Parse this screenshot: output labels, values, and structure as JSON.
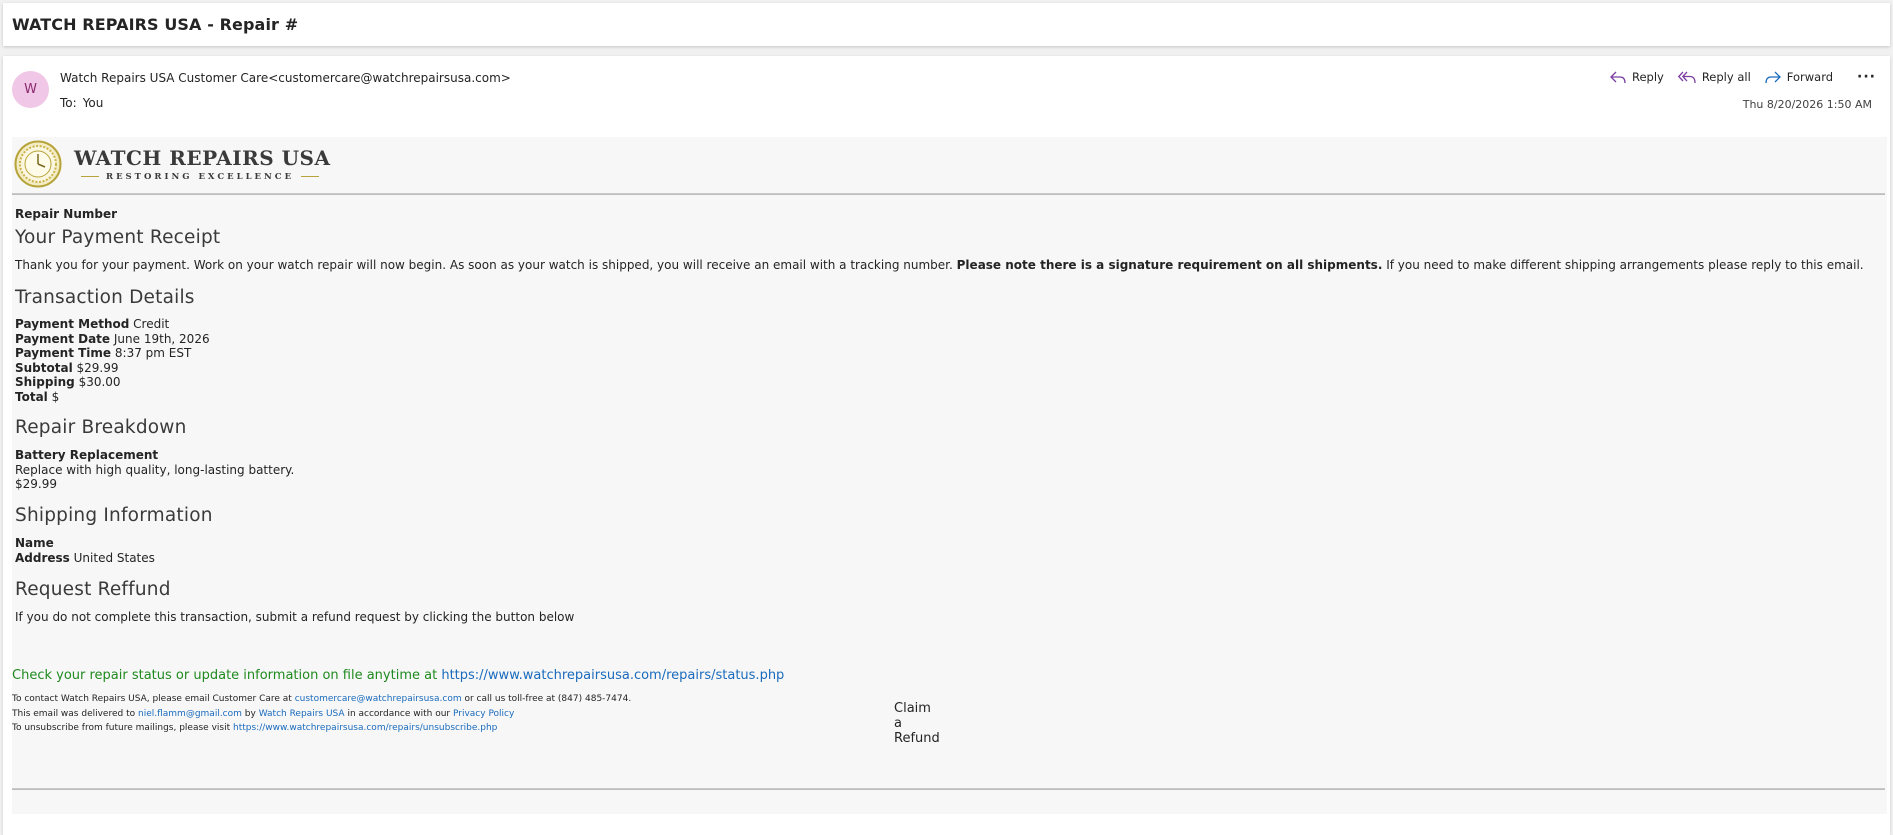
{
  "subject": "WATCH REPAIRS USA - Repair #",
  "sender": {
    "avatar_initial": "W",
    "display": "Watch Repairs USA Customer Care<customercare@watchrepairsusa.com>",
    "to_label": "To:",
    "to_value": "You",
    "date": "Thu 8/20/2026 1:50 AM"
  },
  "actions": {
    "reply": "Reply",
    "reply_all": "Reply all",
    "forward": "Forward",
    "more": "···"
  },
  "logo": {
    "title": "WATCH REPAIRS USA",
    "tagline": "RESTORING EXCELLENCE"
  },
  "body": {
    "repair_number_label": "Repair Number",
    "receipt_heading": "Your Payment Receipt",
    "receipt_text_1": "Thank you for your payment. Work on your watch repair will now begin. As soon as your watch is shipped, you will receive an email with a tracking number.",
    "receipt_text_bold": "Please note there is a signature requirement on all shipments.",
    "receipt_text_2": "If you need to make different shipping arrangements please reply to this email.",
    "transaction_heading": "Transaction Details",
    "transaction": [
      {
        "label": "Payment Method",
        "value": "Credit"
      },
      {
        "label": "Payment Date",
        "value": "June 19th, 2026"
      },
      {
        "label": "Payment Time",
        "value": "8:37 pm EST"
      },
      {
        "label": "Subtotal",
        "value": "$29.99"
      },
      {
        "label": "Shipping",
        "value": "$30.00"
      },
      {
        "label": "Total",
        "value": "$"
      }
    ],
    "breakdown_heading": "Repair Breakdown",
    "breakdown_item": "Battery Replacement",
    "breakdown_desc": "Replace with high quality, long-lasting battery.",
    "breakdown_price": "$29.99",
    "shipping_heading": "Shipping Information",
    "shipping_name_label": "Name",
    "shipping_address_label": "Address",
    "shipping_address_value": "United States",
    "refund_heading": "Request Reffund",
    "refund_text": "If you do not complete this transaction, submit a refund request by clicking the button below",
    "refund_button": "Claim a Refund",
    "status_text": "Check your repair status or update information on file anytime at",
    "status_link": "https://www.watchrepairsusa.com/repairs/status.php"
  },
  "footer": {
    "line1_a": "To contact Watch Repairs USA, please email Customer Care at",
    "line1_link": "customercare@watchrepairsusa.com",
    "line1_b": "or call us toll-free at (847) 485-7474.",
    "line2_a": "This email was delivered to",
    "line2_email": "niel.flamm@gmail.com",
    "line2_b": "by",
    "line2_link": "Watch Repairs USA",
    "line2_c": "in accordance with our",
    "line2_policy": "Privacy Policy",
    "line3_a": "To unsubscribe from future mailings, please visit",
    "line3_link": "https://www.watchrepairsusa.com/repairs/unsubscribe.php"
  },
  "colors": {
    "avatar_bg": "#f0c7e6",
    "status_green": "#1f8a1f",
    "link_blue": "#1a6bbd",
    "action_purple": "#7b3fa0",
    "logo_gold": "#b6a43a"
  }
}
